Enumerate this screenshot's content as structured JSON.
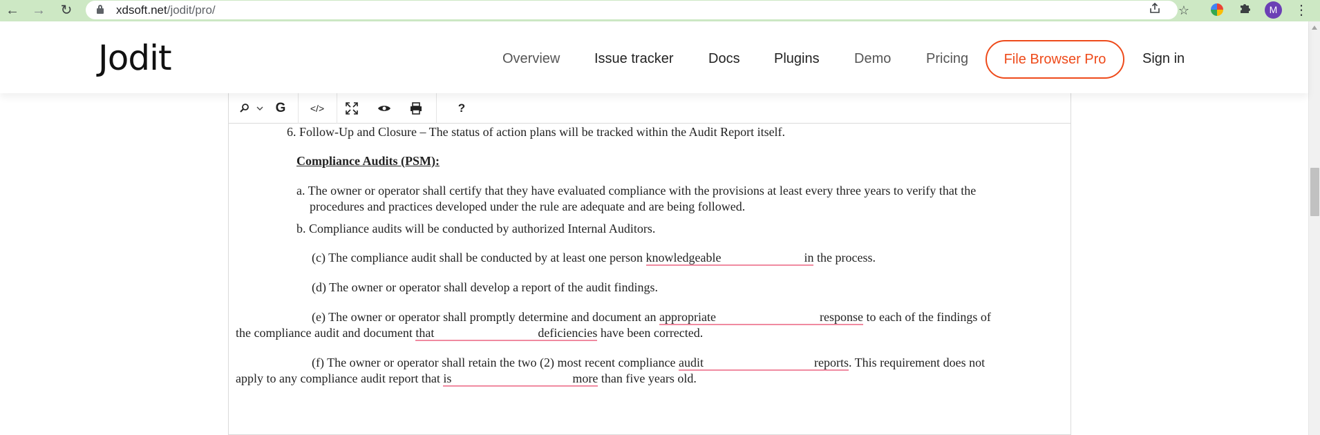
{
  "browser": {
    "url_domain": "xdsoft.net",
    "url_path": "/jodit/pro/",
    "profile_initial": "M",
    "icons": [
      "back-arrow-icon",
      "forward-arrow-icon",
      "reload-icon",
      "lock-icon",
      "share-icon",
      "star-icon",
      "color-extension-icon",
      "puzzle-extensions-icon",
      "kebab-menu-icon"
    ]
  },
  "site": {
    "logo": "Jodit",
    "nav": {
      "overview": "Overview",
      "issue_tracker": "Issue tracker",
      "docs": "Docs",
      "plugins": "Plugins",
      "demo": "Demo",
      "pricing": "Pricing",
      "file_browser_pro": "File Browser Pro",
      "sign_in": "Sign in"
    },
    "accent_color": "#ee4a1a"
  },
  "editor": {
    "toolbar": {
      "find_icon": "search-icon",
      "dropdown_icon": "chevron-down-icon",
      "grammar_label": "G",
      "source_label": "</>",
      "fullsize_icon": "fullscreen-icon",
      "preview_icon": "eye-icon",
      "print_icon": "printer-icon",
      "help_label": "?"
    },
    "content": {
      "line1": "6. Follow-Up and Closure – The status of action plans will be tracked within the Audit Report itself.",
      "heading": "Compliance Audits (PSM):",
      "a1": "a. The owner or operator shall certify that they have evaluated compliance with the provisions at least every three years to verify that the",
      "a2": "procedures and practices developed under the rule are adequate and are being followed.",
      "b": "b. Compliance audits will be conducted by authorized Internal Auditors.",
      "c_pre": "(c) The compliance audit shall be conducted by at least one person ",
      "c_w1": "knowledgeable",
      "c_w2": "in",
      "c_post": " the process.",
      "d": "(d) The owner or operator shall develop a report of the audit findings.",
      "e_pre": "(e) The owner or operator shall promptly determine and document an ",
      "e_w1": "appropriate",
      "e_w2": "response",
      "e_post": " to each of the findings of",
      "e2_pre": "the compliance audit and document ",
      "e2_w1": "that",
      "e2_w2": "deficiencies",
      "e2_post": " have been corrected.",
      "f_pre": "(f) The owner or operator shall retain the two (2) most recent compliance ",
      "f_w1": "audit",
      "f_w2": "reports",
      "f_post": ". This requirement does not",
      "f2_pre": "apply to any compliance audit report that ",
      "f2_w1": "is",
      "f2_w2": "more",
      "f2_post": " than five years old."
    }
  }
}
